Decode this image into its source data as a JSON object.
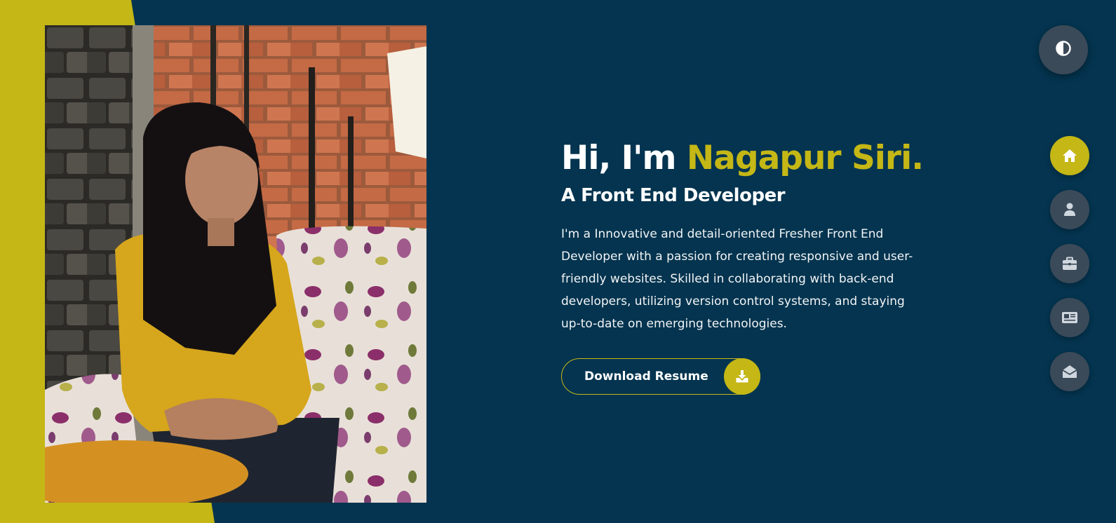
{
  "colors": {
    "background": "#04344f",
    "accent": "#c4b716",
    "button_bg": "#3b4a59"
  },
  "hero": {
    "greeting": "Hi, I'm ",
    "name": "Nagapur Siri.",
    "subtitle": "A Front End Developer",
    "bio": "I'm a Innovative and detail-oriented Fresher Front End Developer with a passion for creating responsive and user-friendly websites. Skilled in collaborating with back-end developers, utilizing version control systems, and staying up-to-date on emerging technologies.",
    "resume_button": {
      "label": "Download Resume",
      "icon": "download-icon"
    }
  },
  "theme_toggle": {
    "icon": "contrast-icon"
  },
  "nav": {
    "items": [
      {
        "id": "home",
        "icon": "home-icon",
        "active": true
      },
      {
        "id": "about",
        "icon": "user-icon",
        "active": false
      },
      {
        "id": "portfolio",
        "icon": "briefcase-icon",
        "active": false
      },
      {
        "id": "blog",
        "icon": "newspaper-icon",
        "active": false
      },
      {
        "id": "contact",
        "icon": "envelope-open-icon",
        "active": false
      }
    ]
  }
}
